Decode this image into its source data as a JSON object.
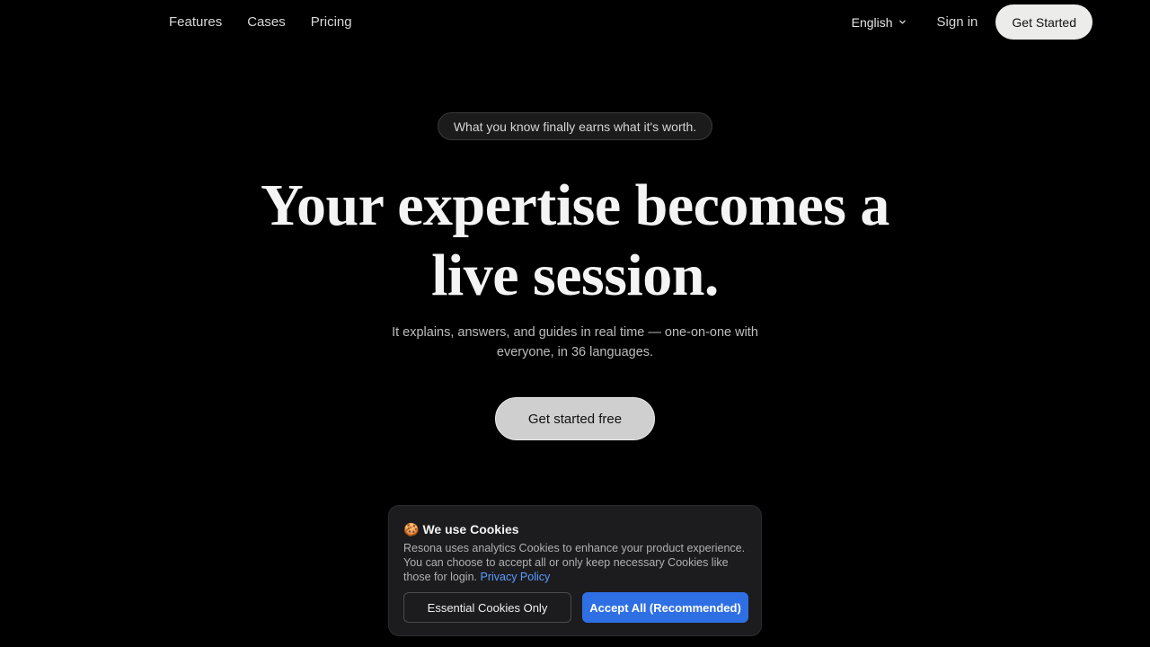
{
  "nav": {
    "links": [
      "Features",
      "Cases",
      "Pricing"
    ],
    "language": "English",
    "language_icon": "chevron-down-icon",
    "sign_in": "Sign in",
    "get_started": "Get Started"
  },
  "hero": {
    "tagline": "What you know finally earns what it's worth.",
    "headline_line1": "Your expertise becomes a",
    "headline_line2": "live session.",
    "subtext_line1": "It explains, answers, and guides in real time — one-on-one with",
    "subtext_line2": "everyone, in 36 languages.",
    "cta": "Get started free"
  },
  "cookie_banner": {
    "emoji": "🍪",
    "title": "We use Cookies",
    "body": "Resona uses analytics Cookies to enhance your product experience. You can choose to accept all or only keep necessary Cookies like those for login.",
    "privacy_link": "Privacy Policy",
    "essential_button": "Essential Cookies Only",
    "accept_button": "Accept All (Recommended)"
  },
  "colors": {
    "background": "#000000",
    "accept_blue": "#2f6fe4",
    "link_blue": "#5b9bff"
  }
}
